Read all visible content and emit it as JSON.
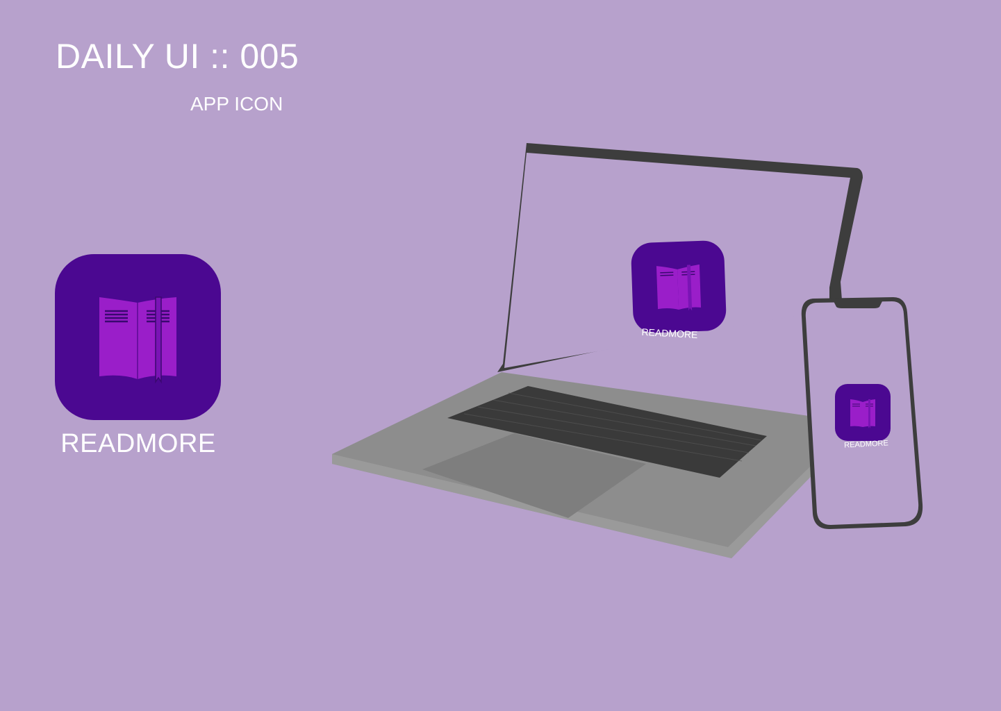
{
  "header": {
    "title": "DAILY UI :: 005",
    "subtitle": "APP ICON"
  },
  "app_icon": {
    "name": "READMORE",
    "icon": "open-book-icon",
    "tile_color": "#4b0891",
    "book_color": "#9a1ec9"
  },
  "laptop": {
    "screen_icon_label": "READMORE",
    "icon": "open-book-icon"
  },
  "phone": {
    "screen_icon_label": "READMORE",
    "icon": "open-book-icon"
  },
  "colors": {
    "background": "#b7a1cc",
    "device_frame": "#3d3d3d",
    "laptop_body": "#8a8a8a"
  }
}
